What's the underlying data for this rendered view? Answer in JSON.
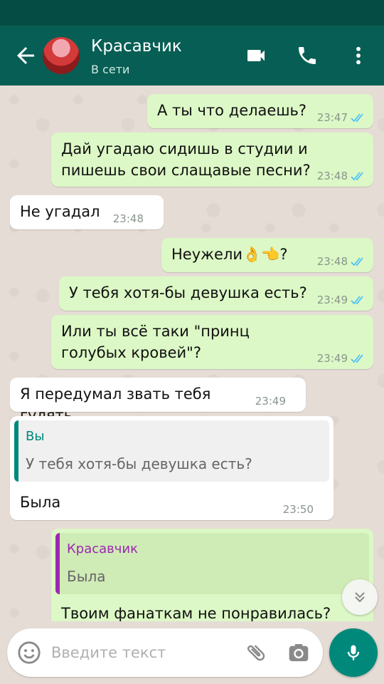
{
  "header": {
    "contact_name": "Красавчик",
    "status": "В сети",
    "colors": {
      "appbar": "#075e54",
      "statusbar": "#054d44"
    },
    "icons": [
      "back-arrow-icon",
      "video-call-icon",
      "phone-icon",
      "more-vert-icon"
    ]
  },
  "messages": [
    {
      "direction": "out",
      "text": "А ты что делаешь?",
      "time": "23:47",
      "read": true
    },
    {
      "direction": "out",
      "text": "Дай угадаю сидишь в студии и пишешь свои слащавые песни?",
      "time": "23:48",
      "read": true
    },
    {
      "direction": "in",
      "text": "Не угадал",
      "time": "23:48"
    },
    {
      "direction": "out",
      "text": "Неужели👌👈?",
      "time": "23:48",
      "read": true
    },
    {
      "direction": "out",
      "text": "У тебя хотя-бы девушка есть?",
      "time": "23:49",
      "read": true
    },
    {
      "direction": "out",
      "text": "Или ты всё таки \"принц голубых кровей\"?",
      "time": "23:49",
      "read": true
    },
    {
      "direction": "in",
      "text": "Я передумал звать тебя гулять",
      "time": "23:49"
    },
    {
      "direction": "in",
      "quote_author": "Вы",
      "quote_text": "У тебя хотя-бы девушка есть?",
      "text": "Была",
      "time": "23:50"
    },
    {
      "direction": "out",
      "quote_author": "Красавчик",
      "quote_text": "Была",
      "text": "Твоим фанаткам не понравилась?"
    }
  ],
  "composer": {
    "placeholder": "Введите текст",
    "icons": [
      "emoji-icon",
      "attach-icon",
      "camera-icon",
      "mic-icon"
    ]
  },
  "colors": {
    "outgoing_bubble": "#dcf8c6",
    "incoming_bubble": "#ffffff",
    "read_tick": "#4fc3f7",
    "quote_you": "#00897b",
    "quote_contact": "#9c27b0",
    "mic_button": "#00897b"
  }
}
